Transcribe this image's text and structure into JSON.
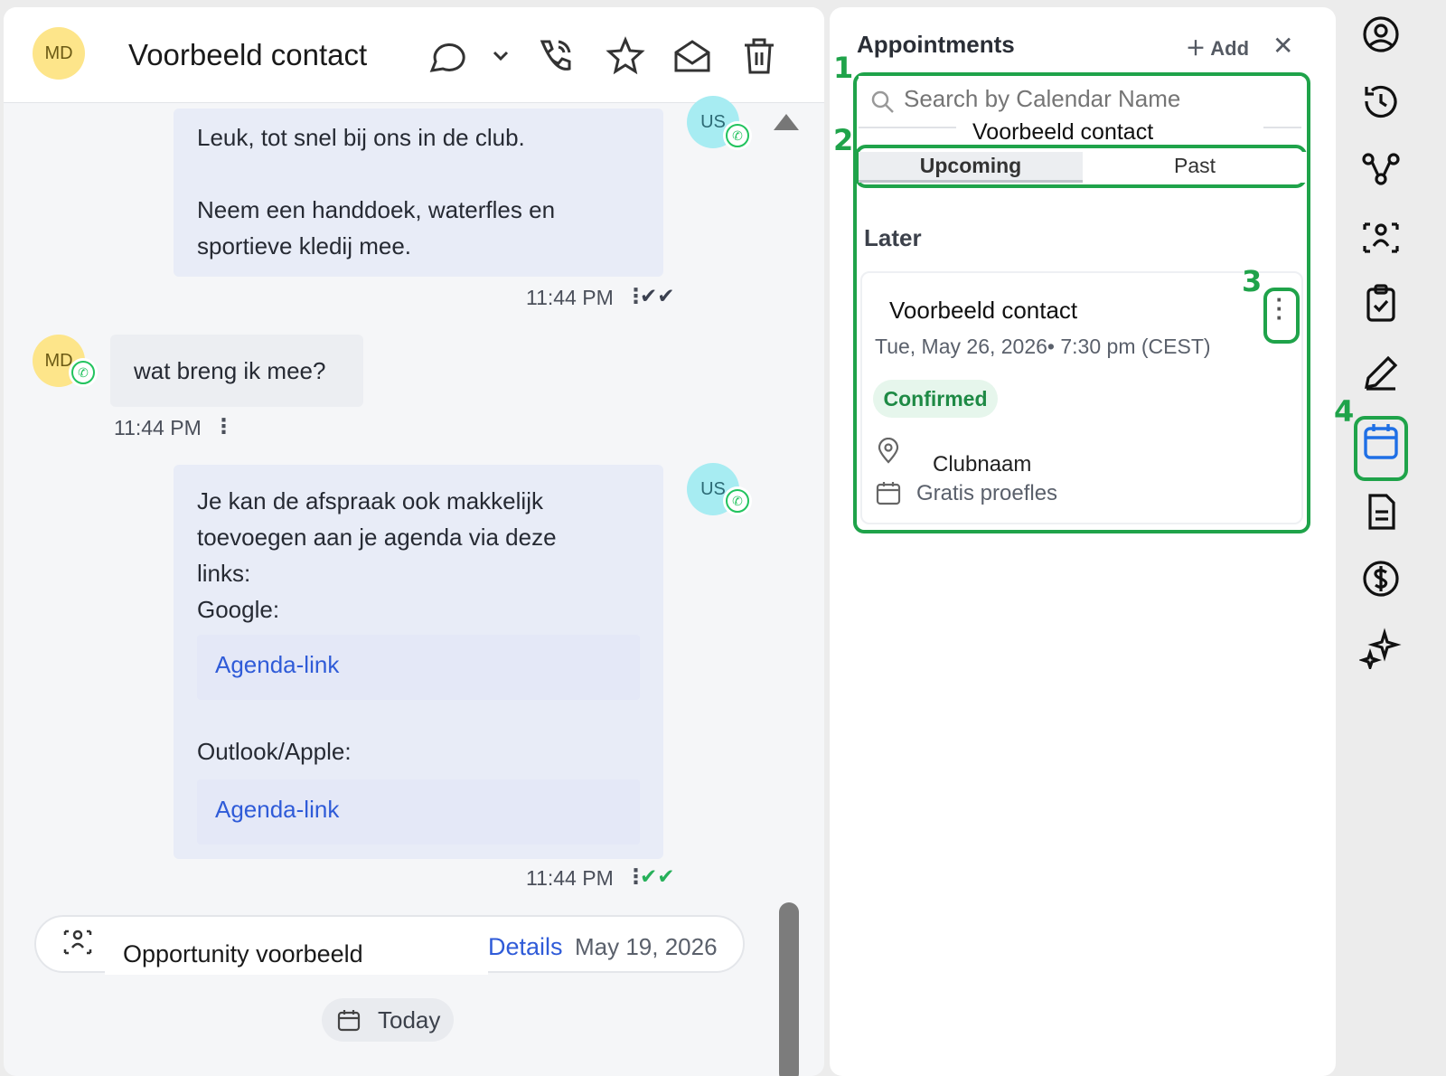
{
  "header": {
    "avatar_initials": "MD",
    "contact_name": "Voorbeeld contact"
  },
  "messages": [
    {
      "direction": "out",
      "sender": "US",
      "lines": [
        "Leuk, tot snel bij ons in de club.",
        "",
        "Neem een handdoek, waterfles en",
        "sportieve kledij mee."
      ],
      "time": "11:44 PM"
    },
    {
      "direction": "in",
      "sender": "MD",
      "lines": [
        "wat breng ik mee?"
      ],
      "time": "11:44 PM"
    },
    {
      "direction": "out",
      "sender": "US",
      "lines": [
        "Je kan de afspraak ook makkelijk",
        "toevoegen aan je agenda via deze",
        "links:",
        "Google:"
      ],
      "links": [
        "Agenda-link",
        "Agenda-link"
      ],
      "outlook_label": "Outlook/Apple:",
      "time": "11:44 PM"
    }
  ],
  "opportunity": {
    "label": "Opportunity voorbeeld",
    "details_link": "Details",
    "date": "May 19, 2026"
  },
  "today_label": "Today",
  "appointments": {
    "title": "Appointments",
    "add_label": "Add",
    "search_placeholder": "Search by Calendar Name",
    "overlay_name": "Voorbeeld contact",
    "tabs": [
      "Upcoming",
      "Past"
    ],
    "section": "Later",
    "card": {
      "title": "Voorbeeld contact",
      "datetime": "Tue, May 26, 2026• 7:30 pm (CEST)",
      "status": "Confirmed",
      "location": "Clubnaam",
      "calendar": "Gratis proefles"
    },
    "annotations": [
      "1",
      "2",
      "3",
      "4"
    ]
  },
  "colors": {
    "annotation_green": "#1fa34a",
    "link_blue": "#2f5bd8",
    "confirmed_green": "#1e8a45",
    "whatsapp_green": "#22c35e"
  }
}
